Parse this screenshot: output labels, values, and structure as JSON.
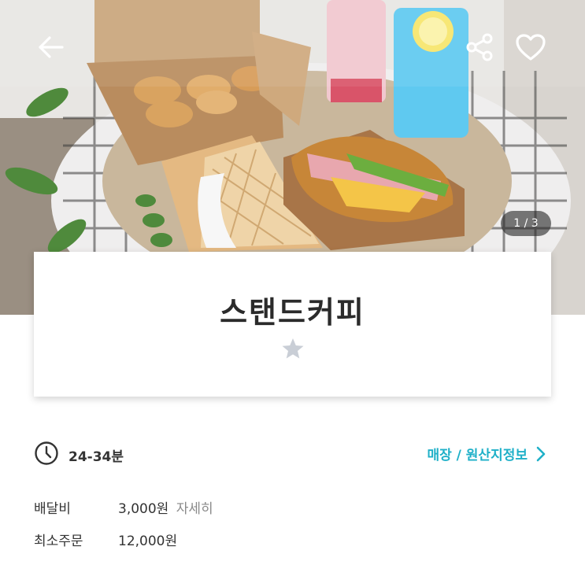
{
  "header": {
    "back_icon": "arrow-left-icon",
    "share_icon": "share-icon",
    "like_icon": "heart-outline-icon"
  },
  "photo": {
    "description_icon": "food-photo",
    "counter": "1 / 3"
  },
  "store": {
    "name": "스탠드커피",
    "rating_icon": "star-icon"
  },
  "info": {
    "delivery_time": "24-34분",
    "origin_link": "매장 / 원산지정보",
    "fee_label": "배달비",
    "fee_value": "3,000원",
    "fee_more": "자세히",
    "min_order_label": "최소주문",
    "min_order_value": "12,000원"
  },
  "colors": {
    "accent": "#1fb0c8",
    "muted": "#8a8a8a",
    "star": "#c9ced6"
  }
}
